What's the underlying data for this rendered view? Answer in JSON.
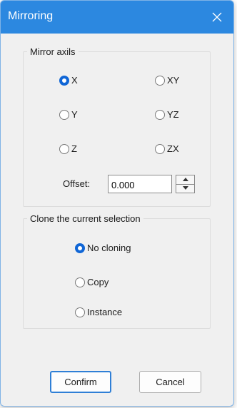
{
  "window": {
    "title": "Mirroring"
  },
  "mirror_axis": {
    "legend": "Mirror axils",
    "options": [
      {
        "label": "X",
        "selected": true
      },
      {
        "label": "XY",
        "selected": false
      },
      {
        "label": "Y",
        "selected": false
      },
      {
        "label": "YZ",
        "selected": false
      },
      {
        "label": "Z",
        "selected": false
      },
      {
        "label": "ZX",
        "selected": false
      }
    ],
    "offset_label": "Offset:",
    "offset_value": "0.000"
  },
  "clone": {
    "legend": "Clone the current selection",
    "options": [
      {
        "label": "No cloning",
        "selected": true
      },
      {
        "label": "Copy",
        "selected": false
      },
      {
        "label": "Instance",
        "selected": false
      }
    ]
  },
  "buttons": {
    "confirm": "Confirm",
    "cancel": "Cancel"
  },
  "colors": {
    "titlebar": "#2c88e0",
    "accent": "#1066d6",
    "dialog_bg": "#f0f0f0"
  },
  "icons": {
    "close": "close-icon",
    "spin_up": "chevron-up-icon",
    "spin_down": "chevron-down-icon"
  }
}
